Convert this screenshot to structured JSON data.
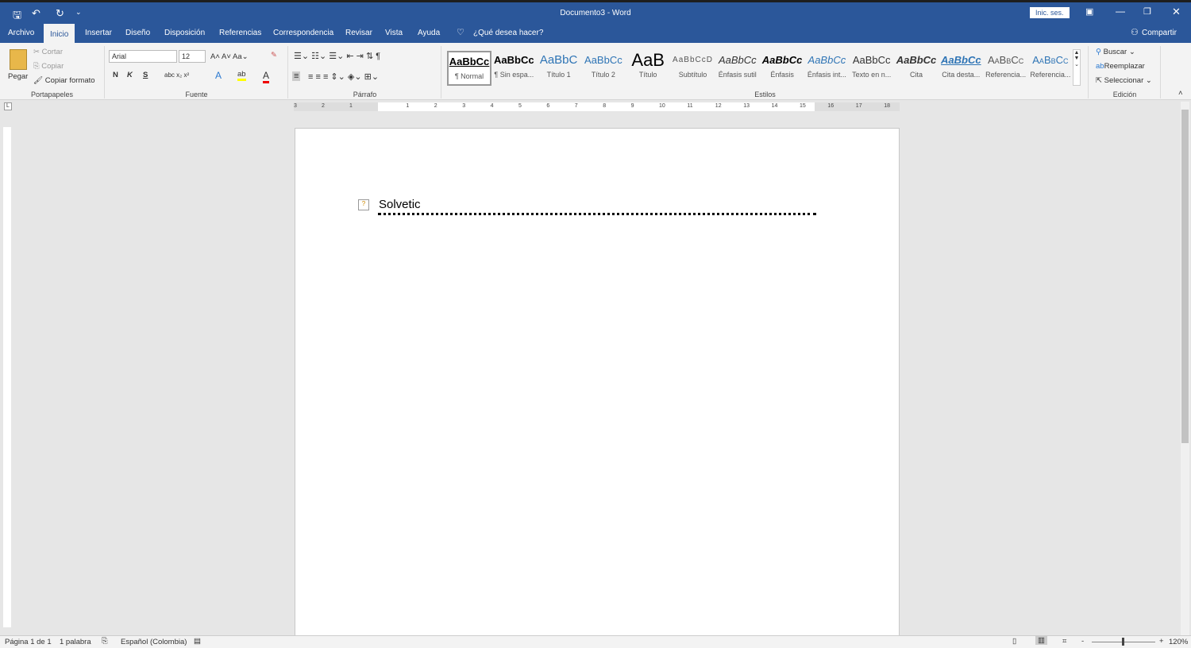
{
  "titlebar": {
    "title": "Documento3 - Word",
    "signin": "Inic. ses."
  },
  "tabs": [
    "Archivo",
    "Inicio",
    "Insertar",
    "Diseño",
    "Disposición",
    "Referencias",
    "Correspondencia",
    "Revisar",
    "Vista",
    "Ayuda"
  ],
  "tell_me": "¿Qué desea hacer?",
  "share": "Compartir",
  "clipboard": {
    "paste": "Pegar",
    "cut": "Cortar",
    "copy": "Copiar",
    "format_painter": "Copiar formato",
    "label": "Portapapeles"
  },
  "font": {
    "name": "Arial",
    "size": "12",
    "bold": "N",
    "italic": "K",
    "underline": "S",
    "label": "Fuente"
  },
  "paragraph": {
    "label": "Párrafo"
  },
  "styles": {
    "label": "Estilos",
    "items": [
      {
        "preview": "AaBbCc",
        "name": "¶ Normal"
      },
      {
        "preview": "AaBbCc",
        "name": "¶ Sin espa..."
      },
      {
        "preview": "AaBbC",
        "name": "Título 1"
      },
      {
        "preview": "AaBbCc",
        "name": "Título 2"
      },
      {
        "preview": "AaB",
        "name": "Título"
      },
      {
        "preview": "AaBbCcD",
        "name": "Subtítulo"
      },
      {
        "preview": "AaBbCc",
        "name": "Énfasis sutil"
      },
      {
        "preview": "AaBbCc",
        "name": "Énfasis"
      },
      {
        "preview": "AaBbCc",
        "name": "Énfasis int..."
      },
      {
        "preview": "AaBbCc",
        "name": "Texto en n..."
      },
      {
        "preview": "AaBbCc",
        "name": "Cita"
      },
      {
        "preview": "AaBbCc",
        "name": "Cita desta..."
      },
      {
        "preview": "AaBbCc",
        "name": "Referencia..."
      },
      {
        "preview": "AaBbCc",
        "name": "Referencia..."
      }
    ]
  },
  "editing": {
    "find": "Buscar",
    "replace": "Reemplazar",
    "select": "Seleccionar",
    "label": "Edición"
  },
  "ruler": [
    "3",
    "2",
    "1",
    "1",
    "2",
    "3",
    "4",
    "5",
    "6",
    "7",
    "8",
    "9",
    "10",
    "11",
    "12",
    "13",
    "14",
    "15",
    "16",
    "17",
    "18"
  ],
  "document": {
    "text": "Solvetic"
  },
  "status": {
    "page": "Página 1 de 1",
    "words": "1 palabra",
    "language": "Español (Colombia)",
    "zoom": "120%"
  }
}
